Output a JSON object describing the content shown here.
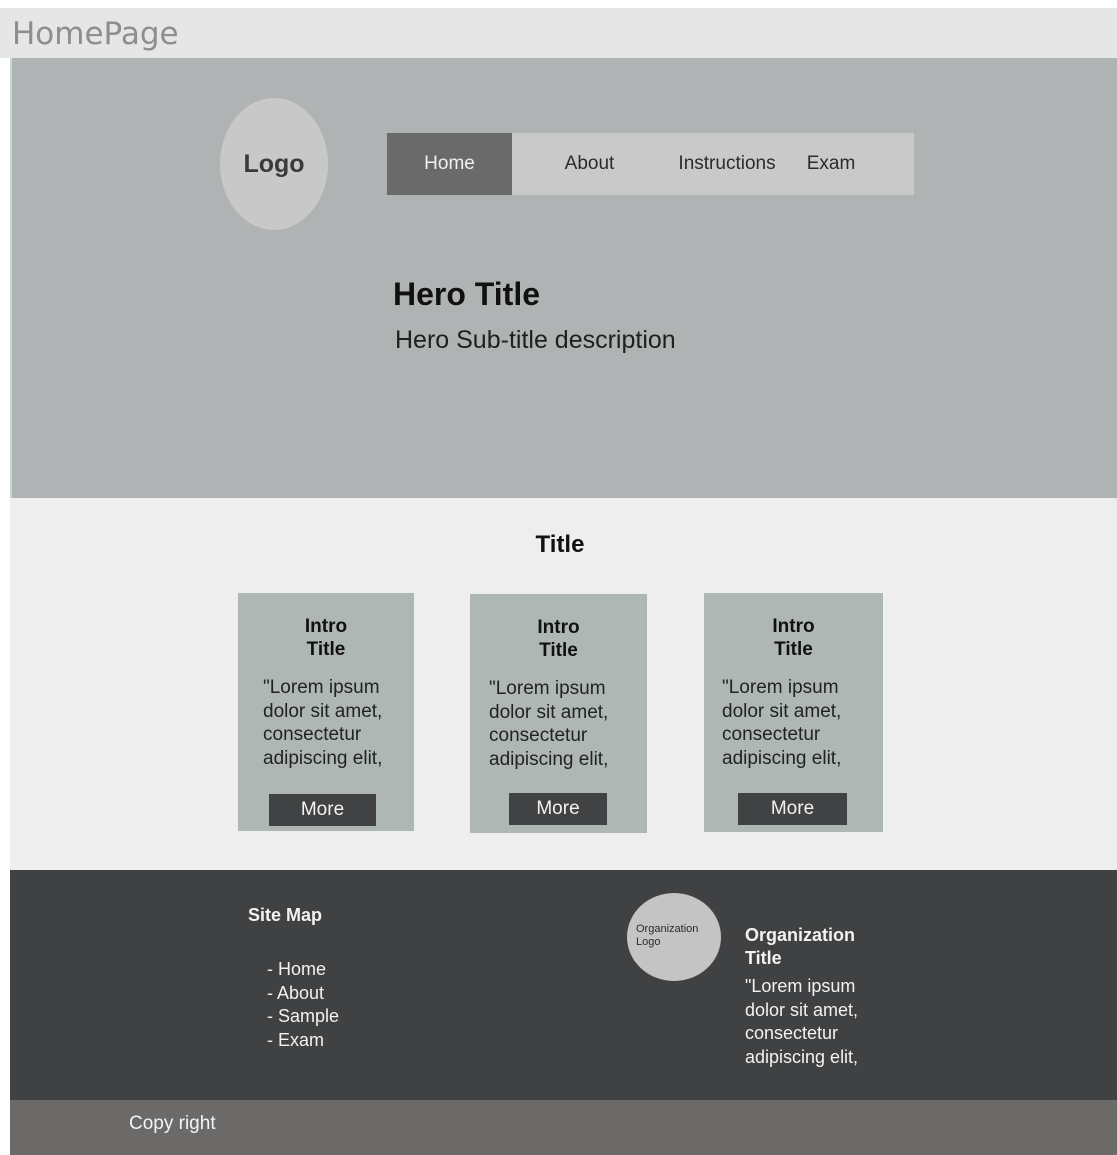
{
  "frame": {
    "label": "HomePage"
  },
  "header": {
    "logo": "Logo",
    "nav": [
      {
        "label": "Home",
        "active": true
      },
      {
        "label": "About",
        "active": false
      },
      {
        "label": "Instructions",
        "active": false
      },
      {
        "label": "Exam",
        "active": false
      }
    ]
  },
  "hero": {
    "title": "Hero Title",
    "subtitle": "Hero Sub-title description"
  },
  "main": {
    "title": "Title",
    "cards": [
      {
        "title": "Intro\nTitle",
        "text": "\"Lorem ipsum dolor sit amet, consectetur adipiscing elit,",
        "button": "More"
      },
      {
        "title": "Intro\nTitle",
        "text": "\"Lorem ipsum dolor sit amet, consectetur adipiscing elit,",
        "button": "More"
      },
      {
        "title": "Intro\nTitle",
        "text": "\"Lorem ipsum dolor sit amet, consectetur adipiscing elit,",
        "button": "More"
      }
    ]
  },
  "footer": {
    "sitemap_title": "Site Map",
    "sitemap_items": [
      "- Home",
      "- About",
      "- Sample",
      "- Exam"
    ],
    "org_logo": "Organization Logo",
    "org_title": "Organization Title",
    "org_text": "\"Lorem ipsum dolor sit amet, consectetur adipiscing elit,",
    "copyright": "Copy right"
  },
  "colors": {
    "hero_bg": "#b0b3b4",
    "nav_bg": "#c9c9c9",
    "nav_active_bg": "#6a6a6a",
    "main_bg": "#eeeeee",
    "card_bg": "#afb7b4",
    "button_bg": "#404243",
    "footer_bg": "#404143",
    "copyright_bg": "#6b6a69"
  }
}
